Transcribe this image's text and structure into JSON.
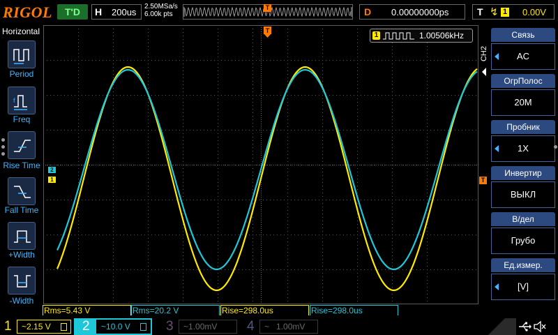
{
  "top": {
    "logo": "RIGOL",
    "run_status": "T'D",
    "horizontal_label": "H",
    "horizontal_value": "200us",
    "sample_rate": "2.50MSa/s",
    "memory_depth": "6.00k pts",
    "delay_label": "D",
    "delay_value": "0.00000000ps",
    "trigger_label": "T",
    "trigger_source": "1",
    "trigger_level": "0.00V",
    "trigger_marker": "T"
  },
  "left_menu": {
    "title": "Horizontal",
    "items": [
      {
        "label": "Period",
        "icon": "period-icon"
      },
      {
        "label": "Freq",
        "icon": "freq-icon"
      },
      {
        "label": "Rise Time",
        "icon": "rise-time-icon"
      },
      {
        "label": "Fall Time",
        "icon": "fall-time-icon"
      },
      {
        "label": "+Width",
        "icon": "pos-width-icon"
      },
      {
        "label": "-Width",
        "icon": "neg-width-icon"
      }
    ]
  },
  "markers": {
    "ch2": "2",
    "ch1": "1",
    "trigger_level": "T"
  },
  "frequency": {
    "channel": "1",
    "value": "1.00506kHz"
  },
  "measurements": [
    {
      "text": "Rms=5.43 V",
      "color": "#ffea00"
    },
    {
      "text": "Rms=20.2 V",
      "color": "#1ec8d8"
    },
    {
      "text": "Rise=298.0us",
      "color": "#ffea00"
    },
    {
      "text": "Rise=298.0us",
      "color": "#1ec8d8"
    }
  ],
  "channels": [
    {
      "num": "1",
      "scale": "2.15 V",
      "coupling": "~",
      "color": "#ffea00",
      "active": true
    },
    {
      "num": "2",
      "scale": "10.0 V",
      "coupling": "~",
      "color": "#1ec8d8",
      "active": true
    },
    {
      "num": "3",
      "scale": "1.00mV",
      "coupling": "~",
      "color": "#6a5070",
      "active": false
    },
    {
      "num": "4",
      "scale": "1.00mV",
      "coupling": "~",
      "color": "#505a80",
      "active": false
    }
  ],
  "right_menu": {
    "tab": "CH2",
    "items": [
      {
        "header": "Связь",
        "value": "AC",
        "arrow": true
      },
      {
        "header": "ОгрПолос",
        "value": "20M",
        "arrow": false
      },
      {
        "header": "Пробник",
        "value": "1X",
        "arrow": true
      },
      {
        "header": "Инвертир",
        "value": "ВЫКЛ",
        "arrow": false
      },
      {
        "header": "В/дел",
        "value": "Грубо",
        "arrow": false
      },
      {
        "header": "Ед.измер.",
        "value": "[V]",
        "arrow": true
      }
    ]
  },
  "waveforms": {
    "ch1": {
      "color": "#ffea00",
      "frequency": "1.00506kHz"
    },
    "ch2": {
      "color": "#1ec8d8"
    }
  }
}
